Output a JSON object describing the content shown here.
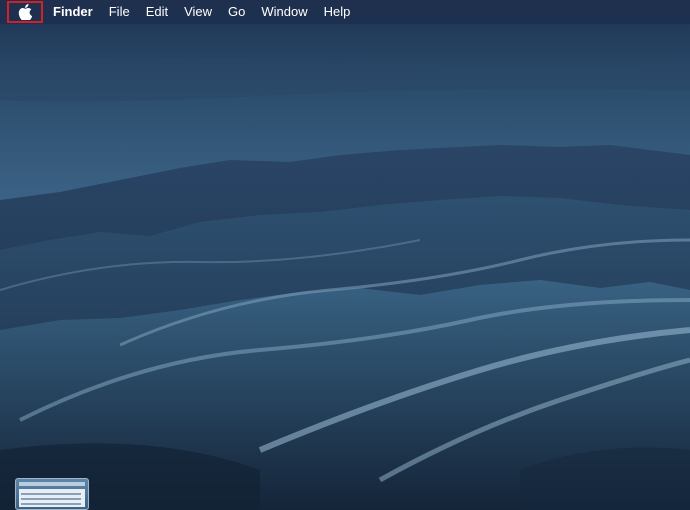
{
  "menubar": {
    "apple_menu_icon": "apple-logo-icon",
    "app_name": "Finder",
    "items": [
      {
        "label": "File"
      },
      {
        "label": "Edit"
      },
      {
        "label": "View"
      },
      {
        "label": "Go"
      },
      {
        "label": "Window"
      },
      {
        "label": "Help"
      }
    ]
  },
  "highlight_color": "#d0202a",
  "desktop": {
    "wallpaper": "mountain-landscape-dusk",
    "thumbnail": "screenshot-thumbnail"
  }
}
